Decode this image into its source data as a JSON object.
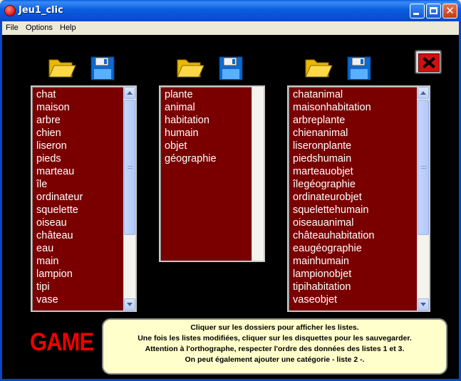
{
  "window": {
    "title": "Jeu1_clic"
  },
  "menu": [
    "File",
    "Options",
    "Help"
  ],
  "lists": [
    {
      "items": [
        "chat",
        "maison",
        "arbre",
        "chien",
        "liseron",
        "pieds",
        "marteau",
        "île",
        "ordinateur",
        "squelette",
        "oiseau",
        "château",
        "eau",
        "main",
        "lampion",
        "tipi",
        "vase"
      ]
    },
    {
      "items": [
        "plante",
        "animal",
        "habitation",
        "humain",
        "objet",
        "géographie"
      ]
    },
    {
      "items": [
        "chatanimal",
        "maisonhabitation",
        "arbreplante",
        "chienanimal",
        "liseronplante",
        "piedshumain",
        "marteauobjet",
        "îlegéographie",
        "ordinateurobjet",
        "squelettehumain",
        "oiseauanimal",
        "châteauhabitation",
        "eaugéographie",
        "mainhumain",
        "lampionobjet",
        "tipihabitation",
        "vaseobjet"
      ]
    }
  ],
  "game_label": "GAME",
  "instructions": [
    "Cliquer sur les dossiers pour afficher les listes.",
    "Une fois les listes modifiées, cliquer sur les disquettes pour les sauvegarder.",
    "Attention à l'orthographe, respecter l'ordre des données des listes 1 et 3.",
    "On peut également ajouter une catégorie - liste 2 -."
  ],
  "colors": {
    "list_bg": "#7a0000",
    "game_text": "#e00000",
    "info_bg": "#ffffcc",
    "client_bg": "#000000"
  },
  "icons": {
    "open": "folder-icon",
    "save": "floppy-disk-icon",
    "exit": "red-x-icon"
  }
}
